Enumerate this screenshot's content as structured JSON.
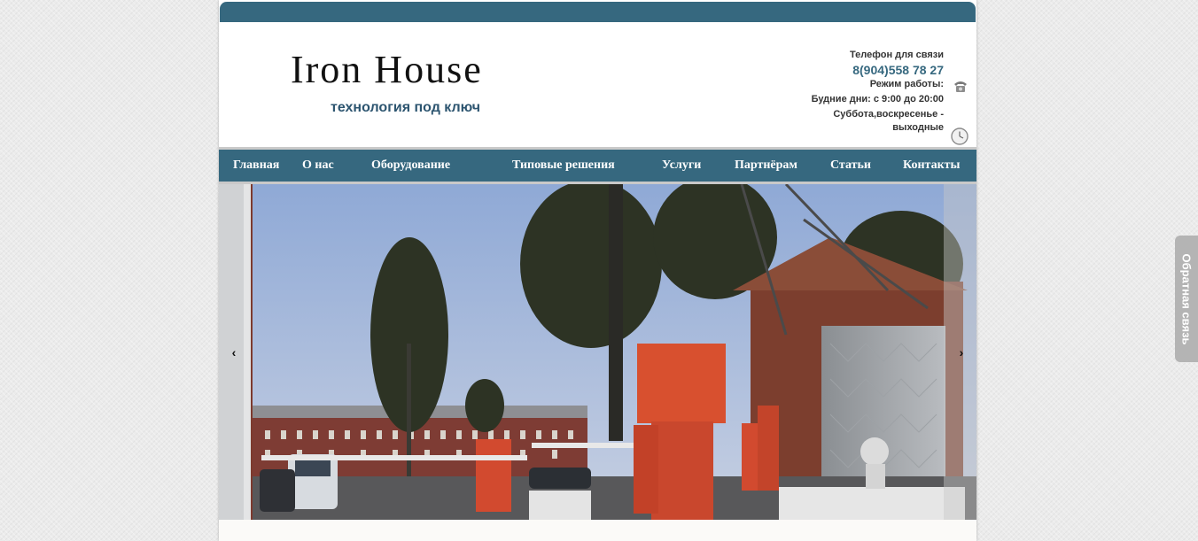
{
  "logo": {
    "text": "Iron House",
    "tagline": "технология под ключ"
  },
  "contacts": {
    "phone_label": "Телефон для связи",
    "phone": "8(904)558 78 27",
    "hours_label": "Режим работы:",
    "weekdays": "Будние дни: с 9:00 до 20:00",
    "weekend_line1": "Суббота,воскресенье -",
    "weekend_line2": "выходные"
  },
  "nav": {
    "items": [
      {
        "label": "Главная"
      },
      {
        "label": "О нас"
      },
      {
        "label": "Оборудование"
      },
      {
        "label": "Типовые решения"
      },
      {
        "label": "Услуги"
      },
      {
        "label": "Партнёрам"
      },
      {
        "label": "Статьи"
      },
      {
        "label": "Контакты"
      }
    ]
  },
  "slider": {
    "prev": "‹",
    "next": "›"
  },
  "feedback": {
    "label": "Обратная связь"
  },
  "icons": {
    "phone": "phone-icon",
    "clock": "clock-icon"
  },
  "colors": {
    "brand": "#36687f",
    "barrier": "#d24a2f"
  }
}
